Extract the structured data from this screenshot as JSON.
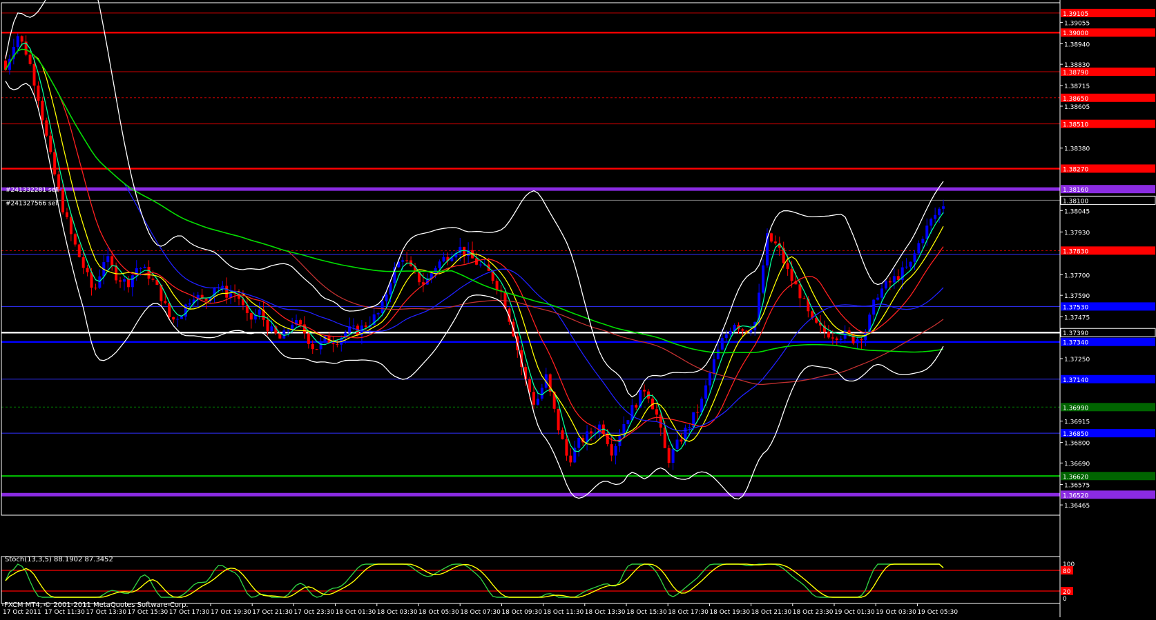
{
  "window": {
    "symbol_caption": "",
    "footer": "FXCM MT4, © 2001-2011 MetaQuotes Software Corp."
  },
  "colors": {
    "background": "#000000",
    "grid_border": "#ffffff",
    "bull_candle": "#0000ff",
    "bear_candle": "#ff0000",
    "ma_fast": "#00ff99",
    "ma_yellow": "#ffff00",
    "ma_red": "#ff2020",
    "ma_blue": "#2020ff",
    "ma_brown": "#c03030",
    "ma_green": "#00dd00",
    "bollinger": "#ffffff",
    "stoch_main": "#2ecc40",
    "stoch_signal": "#ffff00"
  },
  "chart_data": [
    {
      "type": "candlestick",
      "title": "",
      "y_axis": {
        "ylim": [
          1.3641,
          1.3916
        ],
        "tick_labels": [
          "1.39055",
          "1.38940",
          "1.38830",
          "1.38715",
          "1.38605",
          "1.38380",
          "1.38045",
          "1.37930",
          "1.37700",
          "1.37590",
          "1.37475",
          "1.37250",
          "1.36915",
          "1.36800",
          "1.36690",
          "1.36575",
          "1.36465"
        ]
      },
      "x_axis": {
        "tick_labels": [
          "17 Oct 2011",
          "17 Oct 11:30",
          "17 Oct 13:30",
          "17 Oct 15:30",
          "17 Oct 17:30",
          "17 Oct 19:30",
          "17 Oct 21:30",
          "17 Oct 23:30",
          "18 Oct 01:30",
          "18 Oct 03:30",
          "18 Oct 05:30",
          "18 Oct 07:30",
          "18 Oct 09:30",
          "18 Oct 11:30",
          "18 Oct 13:30",
          "18 Oct 15:30",
          "18 Oct 17:30",
          "18 Oct 19:30",
          "18 Oct 21:30",
          "18 Oct 23:30",
          "19 Oct 01:30",
          "19 Oct 03:30",
          "19 Oct 05:30"
        ]
      },
      "price_labels": [
        {
          "value": 1.39105,
          "text": "1.39105",
          "bg": "#ff0000"
        },
        {
          "value": 1.39,
          "text": "1.39000",
          "bg": "#ff0000"
        },
        {
          "value": 1.3879,
          "text": "1.38790",
          "bg": "#ff0000"
        },
        {
          "value": 1.3865,
          "text": "1.38650",
          "bg": "#ff0000"
        },
        {
          "value": 1.3851,
          "text": "1.38510",
          "bg": "#ff0000"
        },
        {
          "value": 1.3827,
          "text": "1.38270",
          "bg": "#ff0000"
        },
        {
          "value": 1.3816,
          "text": "1.38160",
          "bg": "#8a2be2"
        },
        {
          "value": 1.381,
          "text": "1.38100",
          "bg": "#000000"
        },
        {
          "value": 1.3783,
          "text": "1.37830",
          "bg": "#ff0000"
        },
        {
          "value": 1.3753,
          "text": "1.37530",
          "bg": "#0000ff"
        },
        {
          "value": 1.3739,
          "text": "1.37390",
          "bg": "#000000"
        },
        {
          "value": 1.3734,
          "text": "1.37340",
          "bg": "#0000ff"
        },
        {
          "value": 1.3714,
          "text": "1.37140",
          "bg": "#0000ff"
        },
        {
          "value": 1.3699,
          "text": "1.36990",
          "bg": "#006400"
        },
        {
          "value": 1.3685,
          "text": "1.36850",
          "bg": "#0000ff"
        },
        {
          "value": 1.3662,
          "text": "1.36620",
          "bg": "#006400"
        },
        {
          "value": 1.3652,
          "text": "1.36520",
          "bg": "#8a2be2"
        }
      ],
      "horizontal_lines": [
        {
          "value": 1.39105,
          "color": "#cc0000",
          "style": "solid",
          "weight": "thin"
        },
        {
          "value": 1.39,
          "color": "#ff0000",
          "style": "solid",
          "weight": "thick"
        },
        {
          "value": 1.3879,
          "color": "#cc0000",
          "style": "solid",
          "weight": "thin"
        },
        {
          "value": 1.3865,
          "color": "#cc0000",
          "style": "dashed",
          "weight": "thin"
        },
        {
          "value": 1.3851,
          "color": "#cc0000",
          "style": "solid",
          "weight": "thin"
        },
        {
          "value": 1.3827,
          "color": "#ff0000",
          "style": "solid",
          "weight": "thick"
        },
        {
          "value": 1.3816,
          "color": "#8a2be2",
          "style": "solid",
          "weight": "heavy"
        },
        {
          "value": 1.381,
          "color": "#808080",
          "style": "solid",
          "weight": "thin"
        },
        {
          "value": 1.3783,
          "color": "#cc0000",
          "style": "dashed",
          "weight": "thin"
        },
        {
          "value": 1.3781,
          "color": "#3030ff",
          "style": "solid",
          "weight": "thin"
        },
        {
          "value": 1.3753,
          "color": "#3030ff",
          "style": "solid",
          "weight": "thin"
        },
        {
          "value": 1.3739,
          "color": "#ffffff",
          "style": "solid",
          "weight": "thick"
        },
        {
          "value": 1.3734,
          "color": "#0000ff",
          "style": "solid",
          "weight": "thick"
        },
        {
          "value": 1.3714,
          "color": "#3030ff",
          "style": "solid",
          "weight": "thin"
        },
        {
          "value": 1.3699,
          "color": "#008000",
          "style": "dashed",
          "weight": "thin"
        },
        {
          "value": 1.3685,
          "color": "#3030ff",
          "style": "solid",
          "weight": "thin"
        },
        {
          "value": 1.3662,
          "color": "#00aa00",
          "style": "solid",
          "weight": "thick"
        },
        {
          "value": 1.3652,
          "color": "#8a2be2",
          "style": "solid",
          "weight": "heavy"
        }
      ],
      "order_labels": [
        "#241332281 sell",
        "#241327566 sell"
      ],
      "candles_close_path": [
        1.388,
        1.39,
        1.3888,
        1.3865,
        1.3835,
        1.381,
        1.379,
        1.3775,
        1.376,
        1.378,
        1.377,
        1.3765,
        1.3775,
        1.377,
        1.376,
        1.3745,
        1.375,
        1.376,
        1.3755,
        1.3765,
        1.376,
        1.376,
        1.3745,
        1.375,
        1.374,
        1.3735,
        1.3745,
        1.374,
        1.373,
        1.3735,
        1.3735,
        1.374,
        1.374,
        1.3745,
        1.375,
        1.377,
        1.378,
        1.377,
        1.3765,
        1.3775,
        1.378,
        1.3785,
        1.378,
        1.3775,
        1.377,
        1.376,
        1.374,
        1.3715,
        1.37,
        1.3715,
        1.369,
        1.367,
        1.368,
        1.3685,
        1.369,
        1.3675,
        1.369,
        1.37,
        1.371,
        1.3695,
        1.367,
        1.368,
        1.369,
        1.37,
        1.372,
        1.3735,
        1.3745,
        1.374,
        1.3745,
        1.379,
        1.3785,
        1.377,
        1.376,
        1.3745,
        1.374,
        1.3738,
        1.3738,
        1.3735,
        1.374,
        1.376,
        1.3765,
        1.377,
        1.3775,
        1.379,
        1.38,
        1.3808
      ]
    },
    {
      "type": "line",
      "title": "Stoch(13,3,5) 88.1902 87.3452",
      "indicator": "Stochastic Oscillator",
      "ylim": [
        0,
        100
      ],
      "levels": [
        {
          "value": 80,
          "text": "80"
        },
        {
          "value": 20,
          "text": "20"
        }
      ],
      "right_labels": [
        "100",
        "80",
        "20",
        "0"
      ],
      "series": [
        {
          "name": "%K 88.1902",
          "last": 88.1902
        },
        {
          "name": "%D 87.3452",
          "last": 87.3452
        }
      ]
    }
  ]
}
